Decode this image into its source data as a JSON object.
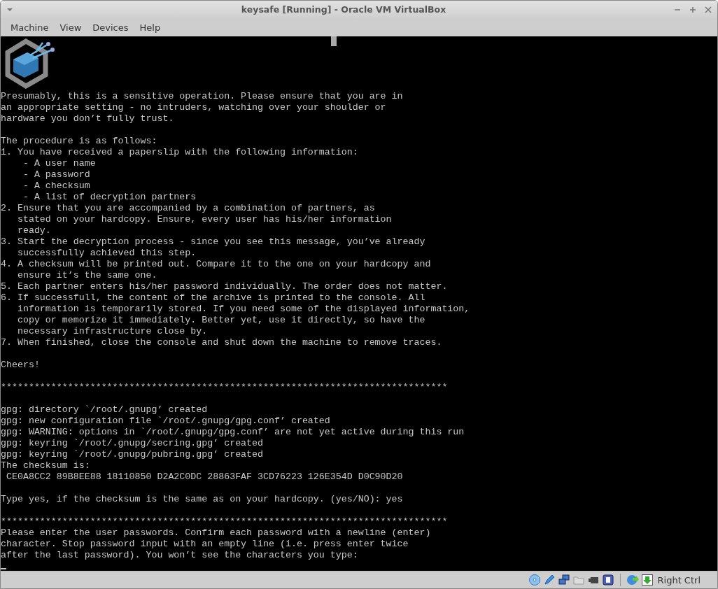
{
  "window": {
    "title": "keysafe [Running] - Oracle VM VirtualBox"
  },
  "menu": [
    "Machine",
    "View",
    "Devices",
    "Help"
  ],
  "console": {
    "blocks": [
      [
        "Presumably, this is a sensitive operation. Please ensure that you are in",
        "an appropriate setting - no intruders, watching over your shoulder or",
        "hardware you don’t fully trust."
      ],
      [
        "The procedure is as follows:",
        "1. You have received a paperslip with the following information:",
        "    - A user name",
        "    - A password",
        "    - A checksum",
        "    - A list of decryption partners",
        "2. Ensure that you are accompanied by a combination of partners, as",
        "   stated on your hardcopy. Ensure, every user has his/her information",
        "   ready.",
        "3. Start the decryption process - since you see this message, you’ve already",
        "   successfully achieved this step.",
        "4. A checksum will be printed out. Compare it to the one on your hardcopy and",
        "   ensure it’s the same one.",
        "5. Each partner enters his/her password individually. The order does not matter.",
        "6. If successfull, the content of the archive is printed to the console. All",
        "   information is temporarily stored. If you need some of the displayed information,",
        "   copy or memorize it immediately. Better yet, use it directly, so have the",
        "   necessary infrastructure close by.",
        "7. When finished, close the console and shut down the machine to remove traces."
      ],
      [
        "Cheers!"
      ],
      [
        "********************************************************************************"
      ],
      [
        "gpg: directory `/root/.gnupg’ created",
        "gpg: new configuration file `/root/.gnupg/gpg.conf’ created",
        "gpg: WARNING: options in `/root/.gnupg/gpg.conf’ are not yet active during this run",
        "gpg: keyring `/root/.gnupg/secring.gpg’ created",
        "gpg: keyring `/root/.gnupg/pubring.gpg’ created",
        "The checksum is:",
        " CE0A8CC2 89B8EE88 18110850 D2A2C0DC 28863FAF 3CD76223 126E354D D0C90D20"
      ],
      [
        "Type yes, if the checksum is the same as on your hardcopy. (yes/NO): yes"
      ],
      [
        "********************************************************************************",
        "Please enter the user passwords. Confirm each password with a newline (enter)",
        "character. Stop password input with an empty line (i.e. press enter twice",
        "after the last password). You won’t see the characters you type:"
      ]
    ]
  },
  "status_bar": {
    "host_key": "Right Ctrl"
  }
}
